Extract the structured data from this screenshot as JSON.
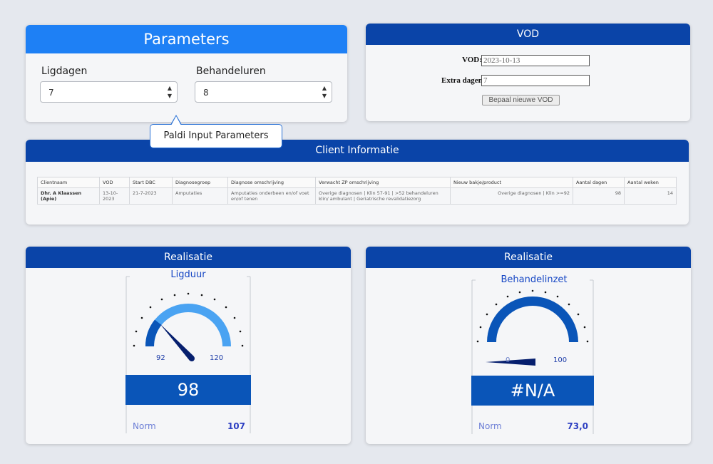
{
  "parameters": {
    "title": "Parameters",
    "ligdagen": {
      "label": "Ligdagen",
      "value": "7"
    },
    "behandeluren": {
      "label": "Behandeluren",
      "value": "8"
    },
    "tooltip": "Paldi Input Parameters"
  },
  "vod": {
    "title": "VOD",
    "vod_label": "VOD:",
    "vod_value": "2023-10-13",
    "extra_label": "Extra dagen:",
    "extra_value": "7",
    "button": "Bepaal nieuwe VOD"
  },
  "client": {
    "title": "Client Informatie",
    "headers": [
      "Clientnaam",
      "VOD",
      "Start DBC",
      "Diagnosegroep",
      "Diagnose omschrijving",
      "Verwacht ZP omschrijving",
      "Nieuw bakje/product",
      "Aantal dagen",
      "Aantal weken"
    ],
    "row": [
      "Dhr. A Klaassen (Apie)",
      "13-10-2023",
      "21-7-2023",
      "Amputaties",
      "Amputaties onderbeen en/of voet en/of tenen",
      "Overige diagnosen | Klin 57-91 | >52 behandeluren klin/ ambulant | Geriatrische revalidatiezorg",
      "Overige diagnosen | Klin >=92",
      "98",
      "14"
    ]
  },
  "realisatie_1": {
    "title": "Realisatie",
    "gauge_title": "Ligduur",
    "min_label": "92",
    "max_label": "120",
    "value": "98",
    "norm_label": "Norm",
    "norm_value": "107",
    "colors": {
      "inner": "#0a55b8",
      "outer": "#4aa3f2",
      "needle": "#061f6e"
    }
  },
  "realisatie_2": {
    "title": "Realisatie",
    "gauge_title": "Behandelinzet",
    "min_label": "0",
    "max_label": "100",
    "value": "#N/A",
    "norm_label": "Norm",
    "norm_value": "73,0",
    "colors": {
      "inner": "#0a55b8",
      "needle": "#061f6e"
    }
  }
}
